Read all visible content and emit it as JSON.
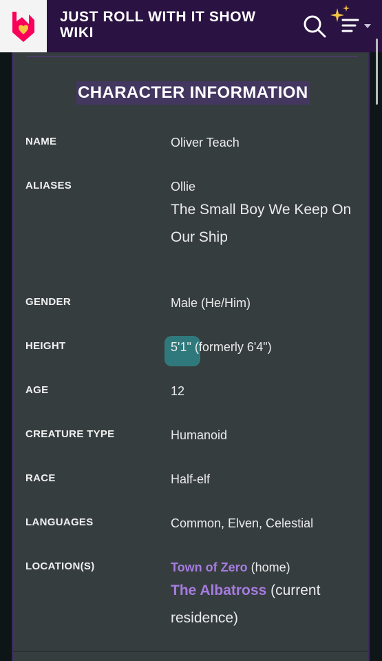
{
  "header": {
    "wiki_title": "JUST ROLL WITH IT SHOW WIKI",
    "logo_icon": "fandom-heart-logo-icon",
    "search_icon": "search-icon",
    "menu_icon": "menu-sparkle-icon",
    "colors": {
      "bar": "#2a1242",
      "accent": "#fa005a",
      "sparkle": "#f5c542"
    }
  },
  "infobox": {
    "section_title": "CHARACTER INFORMATION",
    "rows": {
      "name": {
        "label": "NAME",
        "value": "Oliver Teach"
      },
      "aliases": {
        "label": "ALIASES",
        "value_1": "Ollie",
        "value_2": "The Small Boy We Keep On Our Ship"
      },
      "gender": {
        "label": "GENDER",
        "value": "Male (He/Him)"
      },
      "height": {
        "label": "HEIGHT",
        "value": "5'1\" (formerly 6'4\")"
      },
      "age": {
        "label": "AGE",
        "value": "12"
      },
      "creature_type": {
        "label": "CREATURE TYPE",
        "value": "Humanoid"
      },
      "race": {
        "label": "RACE",
        "value": "Half-elf"
      },
      "languages": {
        "label": "LANGUAGES",
        "value": "Common, Elven, Celestial"
      },
      "locations": {
        "label": "LOCATION(S)",
        "link_1": "Town of Zero",
        "suffix_1": " (home)",
        "link_2": "The Albatross",
        "suffix_2": " (current residence)"
      }
    },
    "colors": {
      "background": "#363d3f",
      "link": "#a67ce0",
      "title_highlight": "#433760"
    }
  }
}
